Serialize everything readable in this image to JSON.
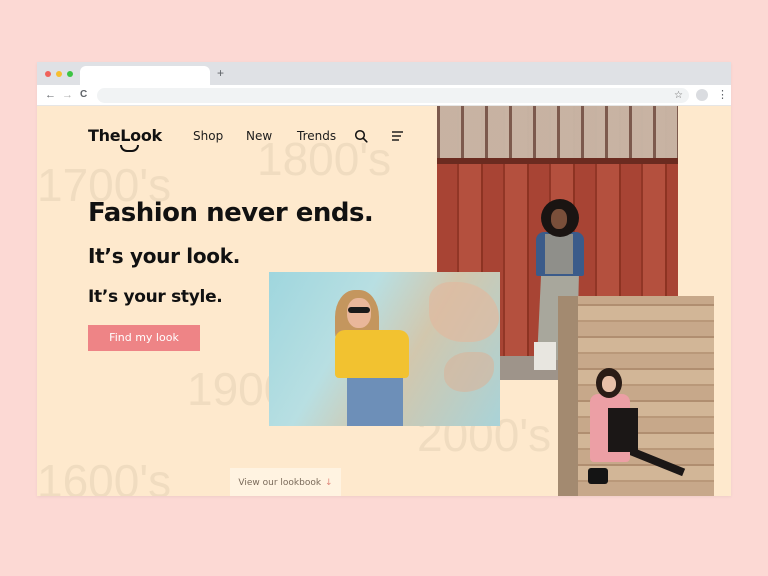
{
  "browser": {
    "new_tab_label": "+",
    "back_label": "←",
    "forward_label": "→",
    "reload_label": "C",
    "bookmark_label": "☆",
    "menu_label": "⋮"
  },
  "header": {
    "logo": "TheLook",
    "nav": [
      "Shop",
      "New",
      "Trends"
    ]
  },
  "background_years": [
    "1700's",
    "1800's",
    "1900's",
    "2000's",
    "1600's"
  ],
  "hero": {
    "headline": "Fashion never ends.",
    "line2": "It’s your look.",
    "line3": "It’s your style.",
    "cta": "Find my look"
  },
  "lookbook": {
    "label": "View our lookbook",
    "arrow": "↓"
  },
  "colors": {
    "page_bg": "#fee9cd",
    "outer_bg": "#fcd9d4",
    "accent": "#ee8486",
    "text": "#111111"
  }
}
